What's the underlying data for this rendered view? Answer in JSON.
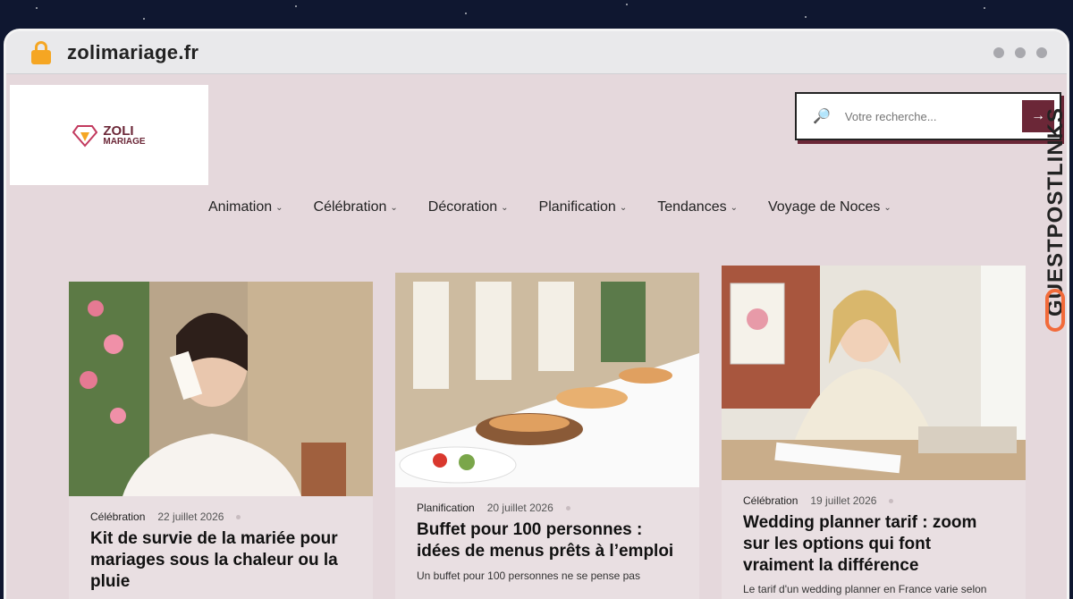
{
  "browser": {
    "url": "zolimariage.fr",
    "lock_icon": "lock-icon"
  },
  "logo": {
    "line1": "ZOLI",
    "line2": "MARIAGE"
  },
  "search": {
    "placeholder": "Votre recherche...",
    "submit_icon": "→"
  },
  "watermark": {
    "text": "GUESTPOSTLINKS"
  },
  "nav": [
    {
      "label": "Animation"
    },
    {
      "label": "Célébration"
    },
    {
      "label": "Décoration"
    },
    {
      "label": "Planification"
    },
    {
      "label": "Tendances"
    },
    {
      "label": "Voyage de Noces"
    }
  ],
  "cards": [
    {
      "category": "Célébration",
      "date": "22 juillet 2026",
      "title": "Kit de survie de la mariée pour mariages sous la chaleur ou la pluie",
      "excerpt": ""
    },
    {
      "category": "Planification",
      "date": "20 juillet 2026",
      "title": "Buffet pour 100 personnes : idées de menus prêts à l’emploi",
      "excerpt": "Un buffet pour 100 personnes ne se pense pas"
    },
    {
      "category": "Célébration",
      "date": "19 juillet 2026",
      "title": "Wedding planner tarif : zoom sur les options qui font vraiment la différence",
      "excerpt": "Le tarif d'un wedding planner en France varie selon"
    }
  ],
  "colors": {
    "accent": "#6b2737",
    "page_bg": "#e5d8dc",
    "lock": "#f5a623",
    "brand": "#f26b3a"
  }
}
